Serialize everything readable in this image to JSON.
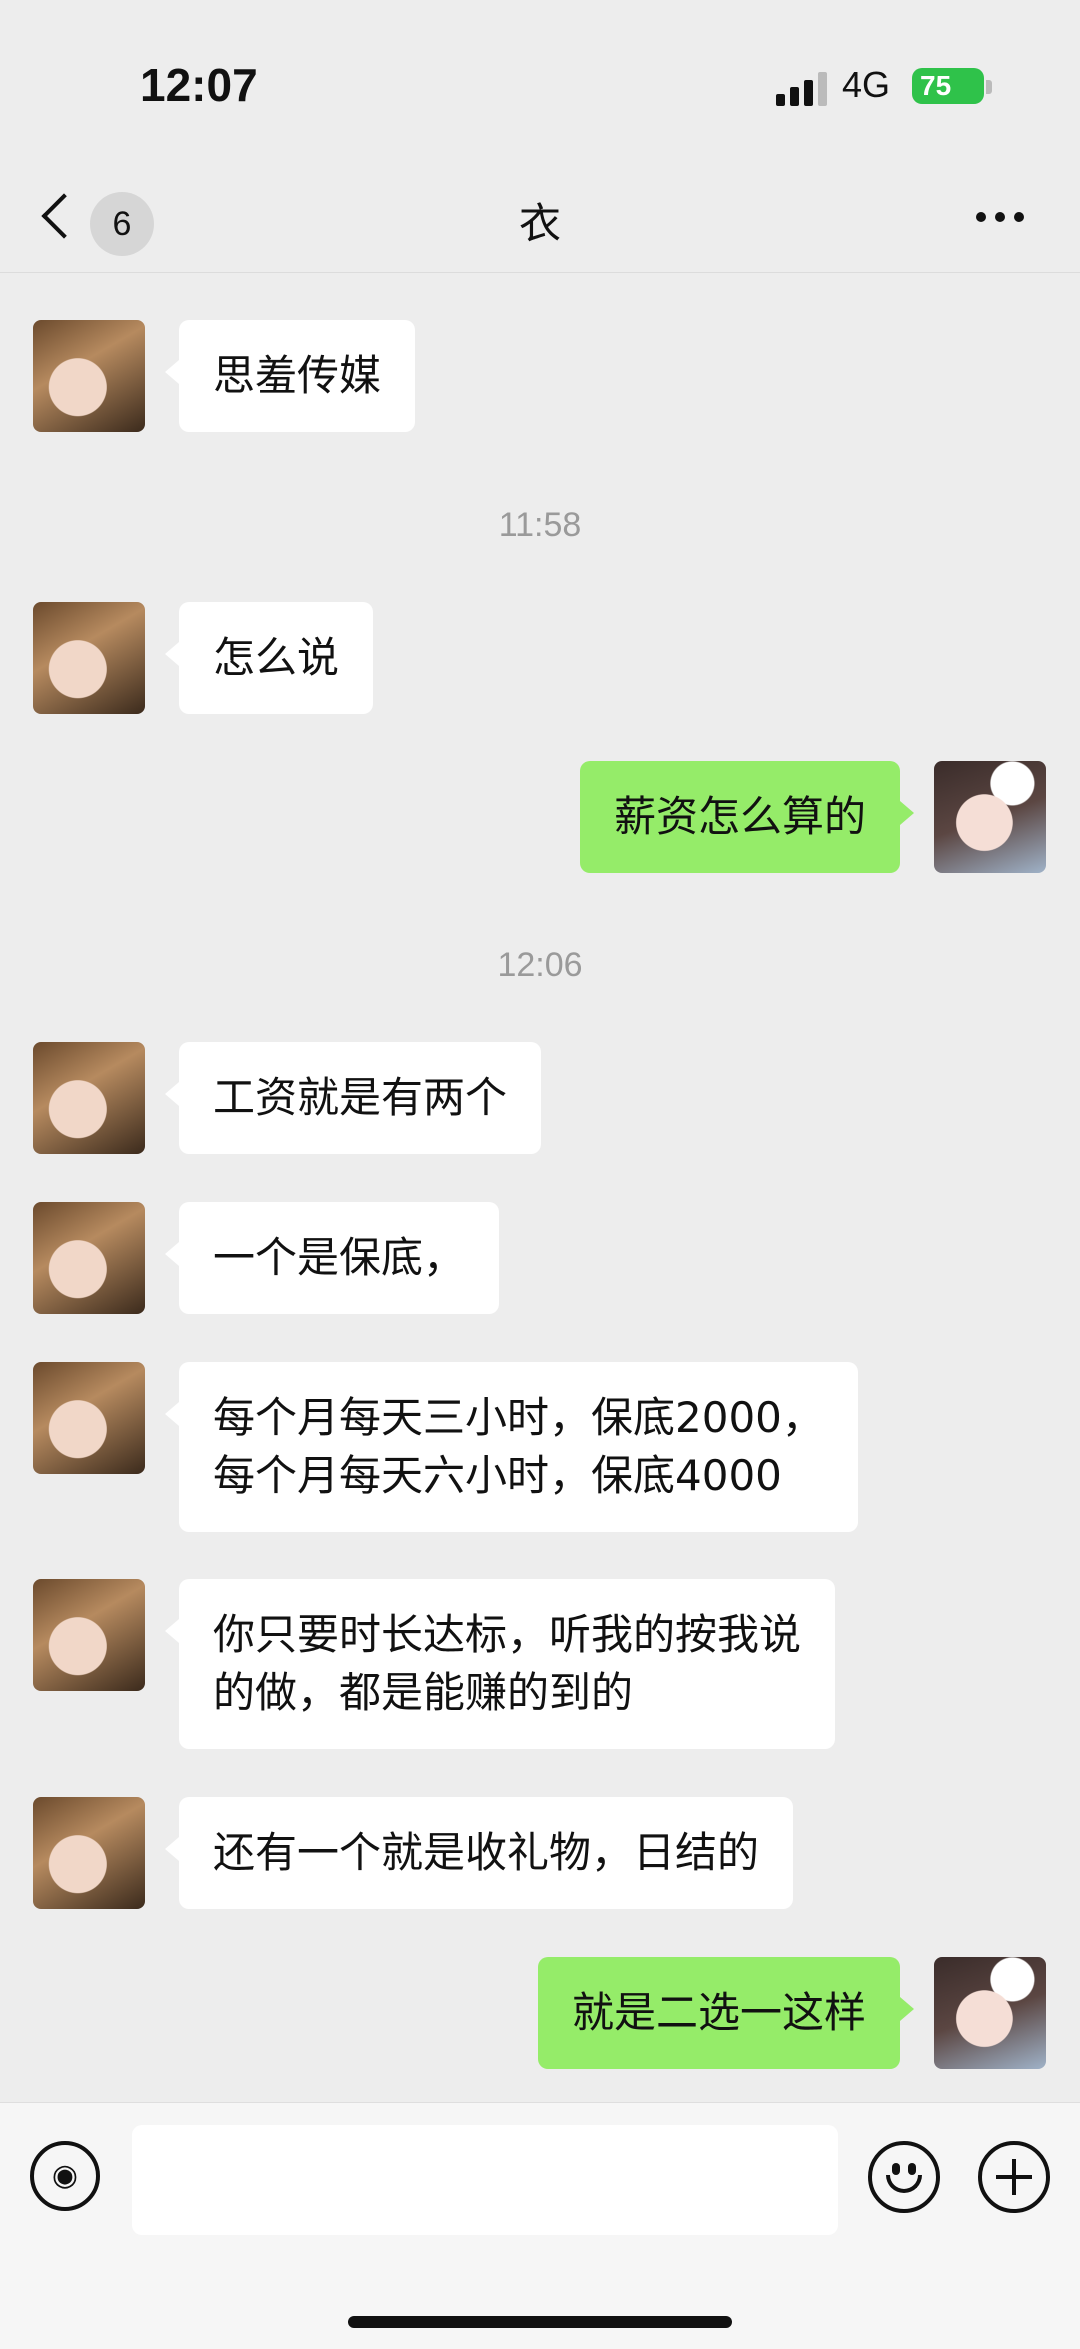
{
  "status_bar": {
    "time": "12:07",
    "network": "4G",
    "battery": "75"
  },
  "nav": {
    "back_label": "<",
    "unread_count": "6",
    "title": "衣",
    "more_icon": "more-icon"
  },
  "timestamps": [
    "11:58",
    "12:06"
  ],
  "messages": [
    {
      "sender": "them",
      "text": "思羞传媒"
    },
    {
      "sender": "them",
      "text": "怎么说"
    },
    {
      "sender": "me",
      "text": "薪资怎么算的"
    },
    {
      "sender": "them",
      "text": "工资就是有两个"
    },
    {
      "sender": "them",
      "text": "一个是保底，"
    },
    {
      "sender": "them",
      "text": "每个月每天三小时，保底2000，\n每个月每天六小时，保底4000"
    },
    {
      "sender": "them",
      "text": "你只要时长达标，听我的按我说\n的做，都是能赚的到的"
    },
    {
      "sender": "them",
      "text": "还有一个就是收礼物，日结的"
    },
    {
      "sender": "me",
      "text": "就是二选一这样"
    }
  ],
  "input": {
    "placeholder": ""
  },
  "colors": {
    "background": "#ededed",
    "my_bubble": "#95ec69",
    "their_bubble": "#ffffff",
    "battery": "#2fc24a"
  }
}
